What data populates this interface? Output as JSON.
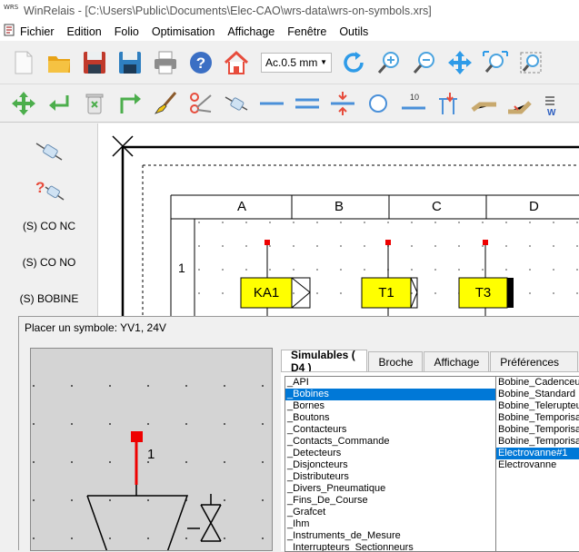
{
  "window": {
    "title": "WinRelais - [C:\\Users\\Public\\Documents\\Elec-CAO\\wrs-data\\wrs-on-symbols.xrs]",
    "icon_text": "WRS"
  },
  "menu": [
    {
      "label": "Fichier"
    },
    {
      "label": "Edition"
    },
    {
      "label": "Folio"
    },
    {
      "label": "Optimisation"
    },
    {
      "label": "Affichage"
    },
    {
      "label": "Fenêtre"
    },
    {
      "label": "Outils"
    }
  ],
  "toolbar1": {
    "icons": [
      "new-file-icon",
      "open-folder-icon",
      "save-icon",
      "save-as-icon",
      "print-icon",
      "help-icon",
      "home-icon"
    ],
    "line_width": "Ac.0.5 mm",
    "icons_right": [
      "refresh-icon",
      "zoom-in-icon",
      "zoom-out-icon",
      "pan-icon",
      "zoom-fit-icon",
      "zoom-window-icon"
    ]
  },
  "toolbar2": {
    "icons": [
      "move-icon",
      "enter-icon",
      "delete-icon",
      "corner-wire-icon",
      "brush-icon",
      "scissors-icon",
      "coil-icon",
      "single-wire-icon",
      "double-wire-icon",
      "cut-wire-icon",
      "circle-icon",
      "wire-number-icon",
      "terminal-icon",
      "cable-icon",
      "cable-pen-icon",
      "more-icon"
    ],
    "wire_number_label": "10"
  },
  "left_panel": {
    "items": [
      {
        "label": "(S) CO NC"
      },
      {
        "label": "(S) CO NO"
      },
      {
        "label": "(S) BOBINE"
      }
    ],
    "symbol_help_mark": "?"
  },
  "schematic": {
    "columns": [
      "A",
      "B",
      "C",
      "D"
    ],
    "row_label": "1",
    "components": [
      {
        "label": "KA1"
      },
      {
        "label": "T1"
      },
      {
        "label": "T3"
      }
    ]
  },
  "dialog": {
    "title": "Placer un symbole:  YV1, 24V",
    "preview_pin_label": "1",
    "tabs": [
      {
        "label": "Simulables ( D4 )",
        "active": true
      },
      {
        "label": "Broche"
      },
      {
        "label": "Affichage"
      },
      {
        "label": "Préférences"
      }
    ],
    "categories": [
      "_API",
      "_Bobines",
      "_Bornes",
      "_Boutons",
      "_Contacteurs",
      "_Contacts_Commande",
      "_Detecteurs",
      "_Disjoncteurs",
      "_Distributeurs",
      "_Divers_Pneumatique",
      "_Fins_De_Course",
      "_Grafcet",
      "_Ihm",
      "_Instruments_de_Mesure",
      "_Interrupteurs_Sectionneurs"
    ],
    "selected_category": "_Bobines",
    "symbols": [
      "Bobine_Cadenceur",
      "Bobine_Standard",
      "Bobine_Telerupteur",
      "Bobine_Temporisation",
      "Bobine_Temporisation",
      "Bobine_Temporisation",
      "Electrovanne#1",
      "Electrovanne"
    ],
    "selected_symbol": "Electrovanne#1"
  }
}
